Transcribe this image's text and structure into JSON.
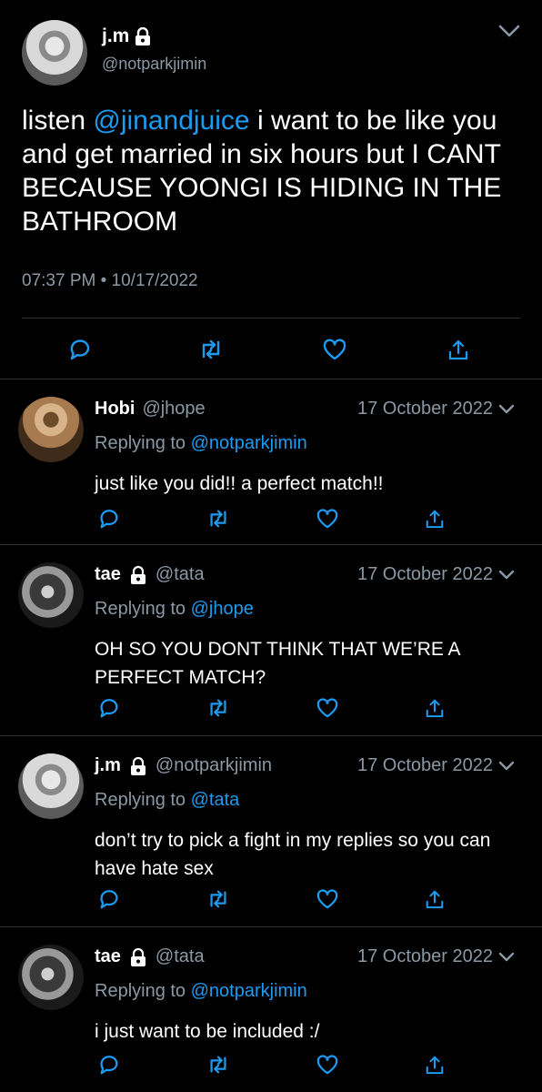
{
  "main_tweet": {
    "name": "j.m",
    "handle": "@notparkjimin",
    "text_prefix": "listen ",
    "mention": "@jinandjuice",
    "text_suffix": " i want to be like you and get married in six hours but I CANT BECAUSE YOONGI IS HIDING IN THE BATHROOM",
    "timestamp": "07:37 PM • 10/17/2022"
  },
  "replies": [
    {
      "name": "Hobi",
      "handle": "@jhope",
      "date": "17 October 2022",
      "replying_label": "Replying to",
      "replying_to": "@notparkjimin",
      "text": "just like you did!! a perfect match!!"
    },
    {
      "name": "tae",
      "handle": "@tata",
      "date": "17 October 2022",
      "replying_label": "Replying to",
      "replying_to": "@jhope",
      "text": "OH SO YOU DONT THINK THAT WE’RE A PERFECT MATCH?"
    },
    {
      "name": "j.m",
      "handle": "@notparkjimin",
      "date": "17 October 2022",
      "replying_label": "Replying to",
      "replying_to": "@tata",
      "text": "don’t try to pick a fight in my replies so you can have hate sex"
    },
    {
      "name": "tae",
      "handle": "@tata",
      "date": "17 October 2022",
      "replying_label": "Replying to",
      "replying_to": "@notparkjimin",
      "text": "i just want to be included :/"
    }
  ],
  "colors": {
    "background": "#000000",
    "link": "#1d9bf0",
    "muted": "#8b98a5",
    "icon": "#1d9bf0",
    "divider": "#2f3336"
  },
  "icons": [
    "lock-icon",
    "chevron-down-icon",
    "reply-icon",
    "retweet-icon",
    "like-icon",
    "share-icon"
  ]
}
